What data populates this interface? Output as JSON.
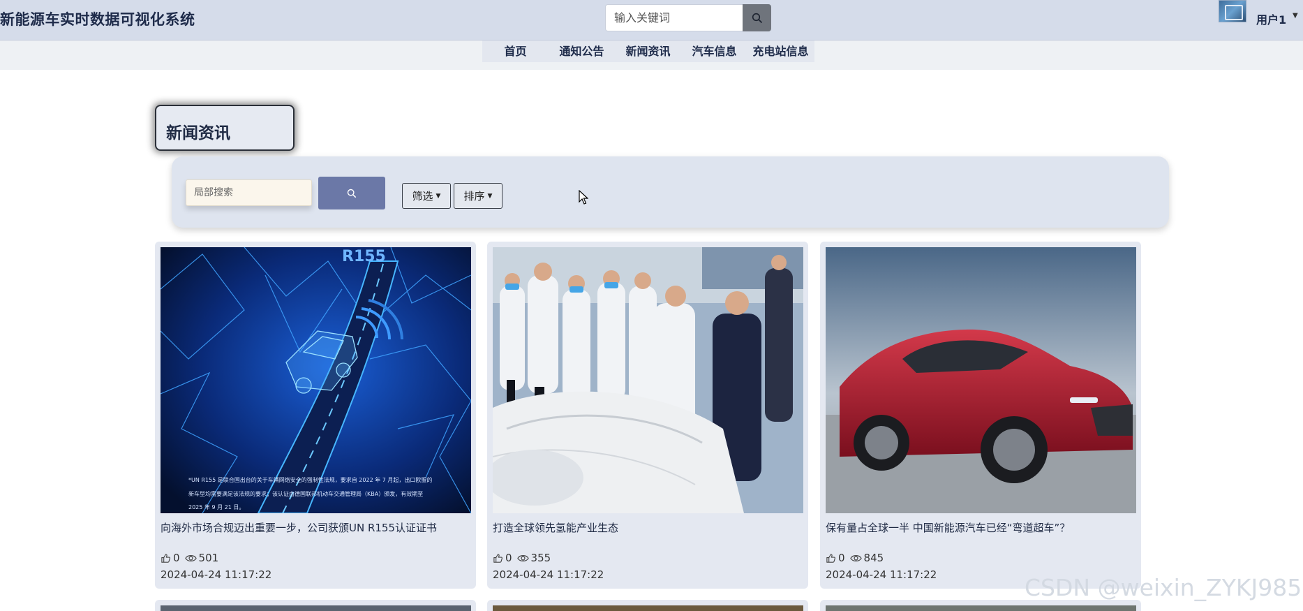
{
  "header": {
    "app_title": "新能源车实时数据可视化系统",
    "search_placeholder": "输入关键词",
    "user_name": "用户1"
  },
  "nav": {
    "items": [
      "首页",
      "通知公告",
      "新闻资讯",
      "汽车信息",
      "充电站信息"
    ]
  },
  "page": {
    "title": "新闻资讯"
  },
  "filters": {
    "local_search_placeholder": "局部搜索",
    "filter_label": "筛选",
    "sort_label": "排序"
  },
  "cards": [
    {
      "title": "向海外市场合规迈出重要一步，公司获颁UN R155认证证书",
      "likes": "0",
      "views": "501",
      "date": "2024-04-24 11:17:22",
      "image_caption_line1": "*UN R155 是联合国出台的关于车辆网络安全的强制性法规，要求自 2022 年 7 月起，出口欧盟的",
      "image_caption_line2": "新车型均需要满足该法规的要求；该认证由德国联邦机动车交通管理局（KBA）颁发，有效期至",
      "image_caption_line3": "2025 年 9 月 21 日。",
      "image_label": "R155"
    },
    {
      "title": "打造全球领先氢能产业生态",
      "likes": "0",
      "views": "355",
      "date": "2024-04-24 11:17:22"
    },
    {
      "title": "保有量占全球一半 中国新能源汽车已经“弯道超车”？",
      "likes": "0",
      "views": "845",
      "date": "2024-04-24 11:17:22"
    }
  ],
  "watermark": "CSDN @weixin_ZYKJ985",
  "colors": {
    "header_bg": "#d5dcea",
    "panel_bg": "#dee4ef",
    "search_btn": "#6b78a7",
    "card_bg": "#e4e8f1"
  }
}
